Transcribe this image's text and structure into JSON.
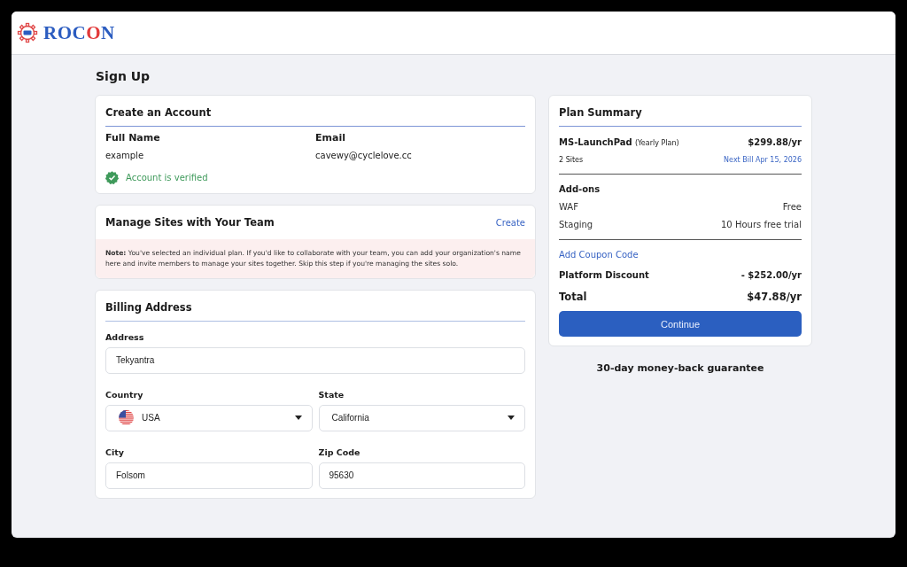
{
  "logo": {
    "segments": [
      {
        "text": "ROC",
        "color": "#2b5cc0"
      },
      {
        "text": "O",
        "color": "#e23a3a"
      },
      {
        "text": "N",
        "color": "#2b5cc0"
      }
    ]
  },
  "page_title": "Sign Up",
  "account": {
    "title": "Create an Account",
    "fields": [
      {
        "label": "Full Name",
        "value": "example"
      },
      {
        "label": "Email",
        "value": "cavewy@cyclelove.cc"
      }
    ],
    "verified": true,
    "verified_text": "Account is verified"
  },
  "team": {
    "title": "Manage Sites with Your Team",
    "action": "Create",
    "note": "**Note:** You've selected an individual plan. If you'd like to collaborate with your team, you can add your organization's name here and invite members to manage your sites together. Skip this step if you're managing the sites solo."
  },
  "billing": {
    "title": "Billing Address",
    "address": {
      "label": "Address",
      "value": "Tekyantra"
    },
    "country": {
      "label": "Country",
      "value": "USA"
    },
    "state": {
      "label": "State",
      "value": "California"
    },
    "city": {
      "label": "City",
      "value": "Folsom"
    },
    "zip": {
      "label": "Zip Code",
      "value": "95630"
    }
  },
  "summary": {
    "title": "Plan Summary",
    "plan": "MS-LaunchPad",
    "plan_note": "(Yearly Plan)",
    "price": "$299.88/yr",
    "sites": "2 Sites",
    "next_bill": "Next Bill Apr 15, 2026",
    "addons_title": "Add-ons",
    "addons": [
      {
        "name": "WAF",
        "value": "Free"
      },
      {
        "name": "Staging",
        "value": "10 Hours free trial"
      }
    ],
    "coupon": "Add Coupon Code",
    "discount_label": "Platform Discount",
    "discount": "- $252.00/yr",
    "total_label": "Total",
    "total": "$47.88/yr",
    "button": "Continue"
  },
  "guarantee": "30-day money-back guarantee"
}
